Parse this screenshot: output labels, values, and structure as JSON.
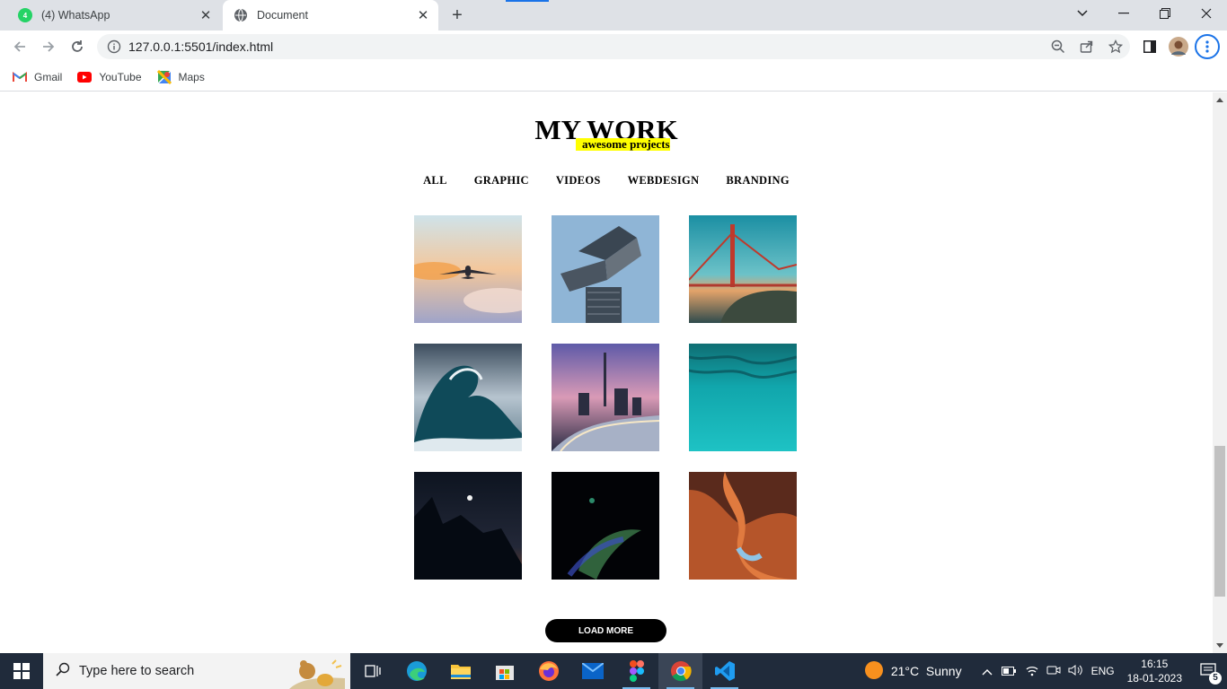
{
  "browser": {
    "tabs": [
      {
        "label": "(4) WhatsApp",
        "badge": "4"
      },
      {
        "label": "Document"
      }
    ],
    "url": "127.0.0.1:5501/index.html",
    "bookmarks": [
      {
        "label": "Gmail"
      },
      {
        "label": "YouTube"
      },
      {
        "label": "Maps"
      }
    ]
  },
  "page": {
    "title": "MY WORK",
    "subtitle": "awesome projects",
    "filters": [
      "ALL",
      "GRAPHIC",
      "VIDEOS",
      "WEBDESIGN",
      "BRANDING"
    ],
    "gallery": [
      {
        "subject": "airplane at sunset"
      },
      {
        "subject": "modern building"
      },
      {
        "subject": "golden gate bridge"
      },
      {
        "subject": "ocean wave"
      },
      {
        "subject": "city skyline at dusk"
      },
      {
        "subject": "underwater turquoise"
      },
      {
        "subject": "mountain silhouette with moon"
      },
      {
        "subject": "abstract dark light"
      },
      {
        "subject": "antelope canyon"
      }
    ],
    "load_more": "LOAD MORE"
  },
  "taskbar": {
    "search_placeholder": "Type here to search",
    "weather": "21°C  Sunny",
    "language": "ENG",
    "time": "16:15",
    "date": "18-01-2023",
    "notifications": "5"
  }
}
